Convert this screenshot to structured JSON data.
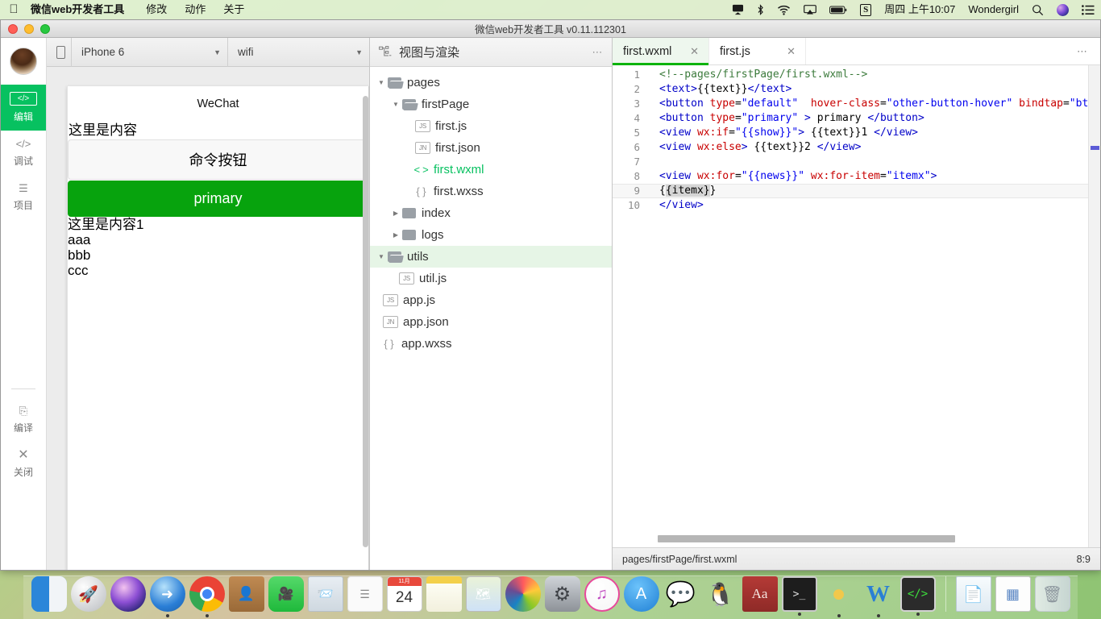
{
  "menubar": {
    "apple_icon": "apple-icon",
    "app_name": "微信web开发者工具",
    "items": [
      "修改",
      "动作",
      "关于"
    ],
    "right": {
      "airplay_display_icon": "display-icon",
      "bluetooth_icon": "bluetooth-icon",
      "wifi_icon": "wifi-icon",
      "screen_mirror_icon": "screen-mirror-icon",
      "battery_icon": "battery-icon",
      "input_method": "S",
      "clock": "周四 上午10:07",
      "user": "Wondergirl",
      "search_icon": "search-icon",
      "siri_icon": "siri-icon",
      "notification_icon": "notification-center-icon"
    }
  },
  "window": {
    "title": "微信web开发者工具 v0.11.112301"
  },
  "rail": {
    "avatar": "user-avatar",
    "items": [
      {
        "icon": "code-icon",
        "glyph": "</>",
        "label": "编辑",
        "active": true
      },
      {
        "icon": "code-icon",
        "glyph": "</>",
        "label": "调试",
        "active": false
      },
      {
        "icon": "list-icon",
        "glyph": "☰",
        "label": "项目",
        "active": false
      }
    ],
    "bottom": [
      {
        "icon": "compile-icon",
        "glyph": "⎘",
        "label": "编译"
      },
      {
        "icon": "close-icon",
        "glyph": "✕",
        "label": "关闭"
      }
    ]
  },
  "simulator": {
    "phone_icon": "phone-icon",
    "device": "iPhone 6",
    "network": "wifi",
    "preview": {
      "nav_title": "WeChat",
      "text_line": "这里是内容",
      "default_button": "命令按钮",
      "primary_button": "primary",
      "view_if_line": "这里是内容1",
      "list_items": [
        "aaa",
        "bbb",
        "ccc"
      ]
    }
  },
  "tree_panel": {
    "header_icon": "sitemap-icon",
    "header_title": "视图与渲染",
    "more_icon": "more-icon",
    "nodes": [
      {
        "label": "pages",
        "depth": 0,
        "kind": "folder",
        "expanded": true,
        "icon": "folder-open-icon"
      },
      {
        "label": "firstPage",
        "depth": 1,
        "kind": "folder",
        "expanded": true,
        "icon": "folder-open-icon"
      },
      {
        "label": "first.js",
        "depth": 2,
        "kind": "file",
        "badge": "JS",
        "icon": "js-file-icon"
      },
      {
        "label": "first.json",
        "depth": 2,
        "kind": "file",
        "badge": "JN",
        "icon": "json-file-icon"
      },
      {
        "label": "first.wxml",
        "depth": 2,
        "kind": "file",
        "badge": "< >",
        "icon": "wxml-file-icon",
        "selected": true
      },
      {
        "label": "first.wxss",
        "depth": 2,
        "kind": "file",
        "badge": "{ }",
        "icon": "wxss-file-icon"
      },
      {
        "label": "index",
        "depth": 1,
        "kind": "folder",
        "expanded": false,
        "icon": "folder-icon"
      },
      {
        "label": "logs",
        "depth": 1,
        "kind": "folder",
        "expanded": false,
        "icon": "folder-icon"
      },
      {
        "label": "utils",
        "depth": 0,
        "kind": "folder",
        "expanded": true,
        "icon": "folder-open-icon",
        "highlighted": true
      },
      {
        "label": "util.js",
        "depth": 1,
        "kind": "file",
        "badge": "JS",
        "icon": "js-file-icon"
      },
      {
        "label": "app.js",
        "depth": 0,
        "kind": "file",
        "badge": "JS",
        "icon": "js-file-icon"
      },
      {
        "label": "app.json",
        "depth": 0,
        "kind": "file",
        "badge": "JN",
        "icon": "json-file-icon"
      },
      {
        "label": "app.wxss",
        "depth": 0,
        "kind": "file",
        "badge": "{ }",
        "icon": "wxss-file-icon"
      }
    ]
  },
  "editor": {
    "tabs": [
      {
        "label": "first.wxml",
        "active": true,
        "close_icon": "close-icon"
      },
      {
        "label": "first.js",
        "active": false,
        "close_icon": "close-icon"
      }
    ],
    "more_icon": "more-icon",
    "lines": [
      {
        "n": "1",
        "text": "<!--pages/firstPage/first.wxml-->"
      },
      {
        "n": "2",
        "text": "<text>{{text}}</text>"
      },
      {
        "n": "3",
        "text": "<button type=\"default\"  hover-class=\"other-button-hover\" bindtap=\"btnCl"
      },
      {
        "n": "4",
        "text": "<button type=\"primary\" > primary </button>"
      },
      {
        "n": "5",
        "text": "<view wx:if=\"{{show}}\"> {{text}}1 </view>"
      },
      {
        "n": "6",
        "text": "<view wx:else> {{text}}2 </view>"
      },
      {
        "n": "7",
        "text": ""
      },
      {
        "n": "8",
        "text": "<view wx:for=\"{{news}}\" wx:for-item=\"itemx\">"
      },
      {
        "n": "9",
        "text": "{{itemx}}"
      },
      {
        "n": "10",
        "text": "</view>"
      }
    ],
    "status": {
      "path": "pages/firstPage/first.wxml",
      "cursor": "8:9"
    }
  },
  "dock": {
    "items": [
      {
        "name": "finder",
        "label": "Finder",
        "running": true
      },
      {
        "name": "launchpad",
        "label": "Launchpad",
        "running": false
      },
      {
        "name": "siri",
        "label": "Siri",
        "running": false
      },
      {
        "name": "safari",
        "label": "Safari",
        "running": true
      },
      {
        "name": "chrome",
        "label": "Google Chrome",
        "running": true
      },
      {
        "name": "contacts",
        "label": "Contacts",
        "running": false
      },
      {
        "name": "facetime",
        "label": "FaceTime",
        "running": false
      },
      {
        "name": "mail",
        "label": "Mail",
        "running": false
      },
      {
        "name": "reminders",
        "label": "Reminders",
        "running": false
      },
      {
        "name": "calendar",
        "label": "Calendar",
        "running": false,
        "month": "11月",
        "day": "24"
      },
      {
        "name": "notes",
        "label": "Notes",
        "running": false
      },
      {
        "name": "maps",
        "label": "Maps",
        "running": false
      },
      {
        "name": "photos",
        "label": "Photos",
        "running": false
      },
      {
        "name": "system-prefs",
        "label": "System Preferences",
        "running": false
      },
      {
        "name": "itunes",
        "label": "iTunes",
        "running": false
      },
      {
        "name": "app-store",
        "label": "App Store",
        "running": false
      },
      {
        "name": "wechat",
        "label": "WeChat",
        "running": false
      },
      {
        "name": "qq",
        "label": "QQ",
        "running": false
      },
      {
        "name": "dictionary",
        "label": "Dictionary",
        "running": false
      },
      {
        "name": "terminal",
        "label": "Terminal",
        "running": true
      },
      {
        "name": "cheese",
        "label": "Evernote",
        "running": true
      },
      {
        "name": "word",
        "label": "Word",
        "running": true
      },
      {
        "name": "devtools",
        "label": "微信web开发者工具",
        "running": true
      }
    ],
    "right_items": [
      {
        "name": "downloads-stack",
        "label": "Downloads"
      },
      {
        "name": "apps-stack",
        "label": "Applications"
      },
      {
        "name": "trash",
        "label": "Trash"
      }
    ]
  }
}
